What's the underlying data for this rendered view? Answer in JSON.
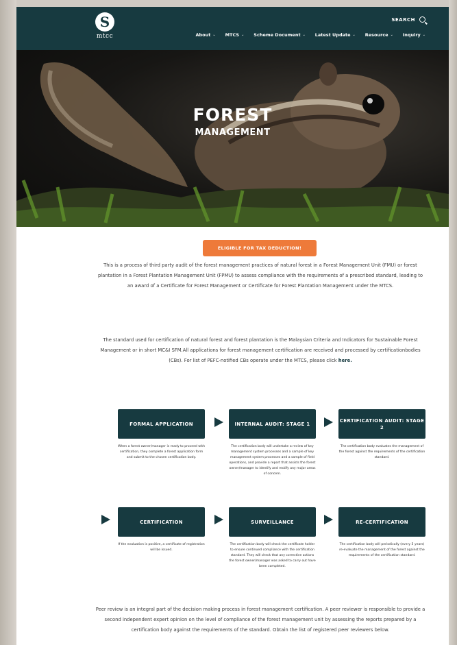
{
  "nav": {
    "logo_mark": "S",
    "logo_text": "mtcc",
    "search_label": "SEARCH",
    "menu": [
      {
        "label": "About"
      },
      {
        "label": "MTCS"
      },
      {
        "label": "Scheme Document"
      },
      {
        "label": "Latest Update"
      },
      {
        "label": "Resource"
      },
      {
        "label": "Inquiry"
      }
    ]
  },
  "hero": {
    "title": "FOREST",
    "subtitle": "MANAGEMENT"
  },
  "tax_button": "ELIGIBLE FOR TAX DEDUCTION!",
  "intro": "This is a process of third party audit of the forest management practices of natural forest in a Forest Management Unit (FMU) or forest plantation in a Forest Plantation Management Unit (FPMU) to assess compliance with the requirements of a prescribed standard, leading to an award of a Certificate for Forest Management or Certificate for Forest Plantation Management under the MTCS.",
  "standard": {
    "text": "The standard used for certification of natural forest and forest plantation is the Malaysian Criteria and Indicators for Sustainable Forest Management or in short MC&I SFM.All applications for forest management certification are received and processed by certificationbodies (CBs). For list of PEFC-notified CBs operate under the MTCS, please click",
    "link": "here."
  },
  "steps": [
    {
      "title": "FORMAL APPLICATION",
      "desc": "When a forest owner/manager is ready to proceed with certification, they complete a forest application form and submit to the chosen certification body."
    },
    {
      "title": "INTERNAL AUDIT: STAGE 1",
      "desc": "The certification body will undertake a review of key management system processes and a sample of key management system processes and a sample of field operations, and provide a report that assists the forest owner/manager to identify and rectify any major areas of concern."
    },
    {
      "title": "CERTIFICATION AUDIT: STAGE 2",
      "desc": "The certification body evaluates the management of the forest against the requirements of the certification standard."
    },
    {
      "title": "CERTIFICATION",
      "desc": "If the evaluation is positive, a certificate of registration will be issued."
    },
    {
      "title": "SURVEILLANCE",
      "desc": "The certification body will check the certificate holder to ensure continued compliance with the certification standard. They will check that any corrective actions the forest owner/manager was asked to carry out have been completed."
    },
    {
      "title": "RE-CERTIFICATION",
      "desc": "The certification body will periodically (every 5 years) re-evaluate the management of the forest against the requirements of the certification standard."
    }
  ],
  "peer_review": "Peer review is an integral part of the decision making process in forest management certification. A peer reviewer is responsible to provide a second independent expert opinion on the level of compliance of the forest management unit by assessing the reports prepared by a certification body against the requirements of the standard. Obtain the list of registered peer reviewers below.",
  "colors": {
    "primary": "#173a40",
    "accent": "#ee7a3a"
  }
}
